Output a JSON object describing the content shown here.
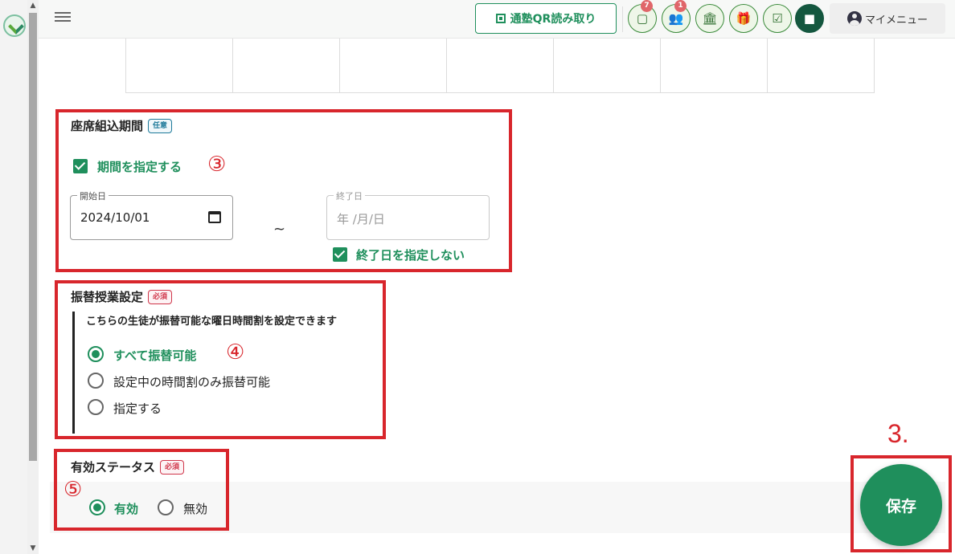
{
  "header": {
    "qr_button_label": "通塾QR読み取り",
    "icons": [
      {
        "name": "chat-bubble-icon",
        "badge": "7"
      },
      {
        "name": "group-icon",
        "badge": "1"
      },
      {
        "name": "school-icon"
      },
      {
        "name": "gift-icon"
      },
      {
        "name": "checklist-icon"
      },
      {
        "name": "message-icon"
      }
    ],
    "my_menu_label": "マイメニュー"
  },
  "seat_period": {
    "title": "座席組込期間",
    "tag": "任意",
    "specify_period_label": "期間を指定する",
    "start_date_label": "開始日",
    "start_date_value": "2024/10/01",
    "separator": "~",
    "end_date_label": "終了日",
    "end_date_placeholder": "年 /月/日",
    "no_end_date_label": "終了日を指定しない"
  },
  "substitute": {
    "title": "振替授業設定",
    "tag": "必須",
    "description": "こちらの生徒が振替可能な曜日時間割を設定できます",
    "options": [
      "すべて振替可能",
      "設定中の時間割のみ振替可能",
      "指定する"
    ],
    "selected": "すべて振替可能"
  },
  "status": {
    "title": "有効ステータス",
    "tag": "必須",
    "options": [
      "有効",
      "無効"
    ],
    "selected": "有効"
  },
  "annotations": {
    "three_circled": "③",
    "four_circled": "④",
    "five_circled": "⑤",
    "step_label": "3."
  },
  "save_label": "保存",
  "colors": {
    "primary_green": "#1f8f5c",
    "dark_green": "#14573f",
    "annotation_red": "#d8262c",
    "required_red": "#d0364a",
    "optional_blue": "#1e7a9a"
  }
}
